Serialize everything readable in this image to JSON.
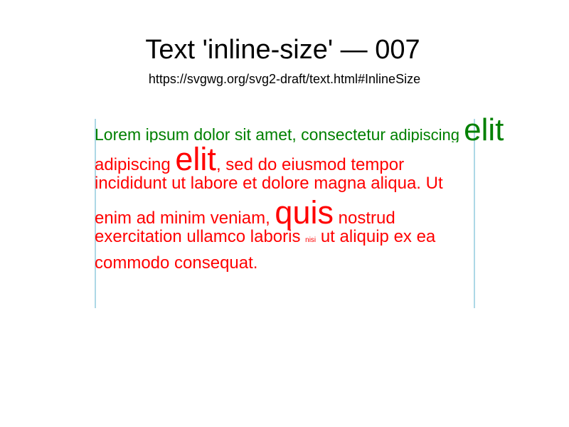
{
  "header": {
    "title": "Text 'inline-size' — 007",
    "url": "https://svgwg.org/svg2-draft/text.html#InlineSize"
  },
  "colors": {
    "reference_text": "#008000",
    "test_text": "#ff0000",
    "guide_lines": "#add8e6"
  },
  "reference_line": {
    "part1": "Lorem ipsum dolor sit amet, consectetur",
    "part2": " adipiscing ",
    "part3": "elit"
  },
  "test_text": {
    "line1": {
      "a": "adipiscing ",
      "big": "elit",
      "b": ", sed do eiusmod tempor"
    },
    "line2": "incididunt ut labore et dolore magna aliqua. Ut",
    "line3": {
      "a": "enim ad minim veniam, ",
      "big": "quis",
      "b": " nostrud"
    },
    "line4": {
      "a": "exercitation ullamco laboris ",
      "tiny": "nisi",
      "b": " ut aliquip ex ea"
    },
    "line5": "commodo consequat."
  }
}
